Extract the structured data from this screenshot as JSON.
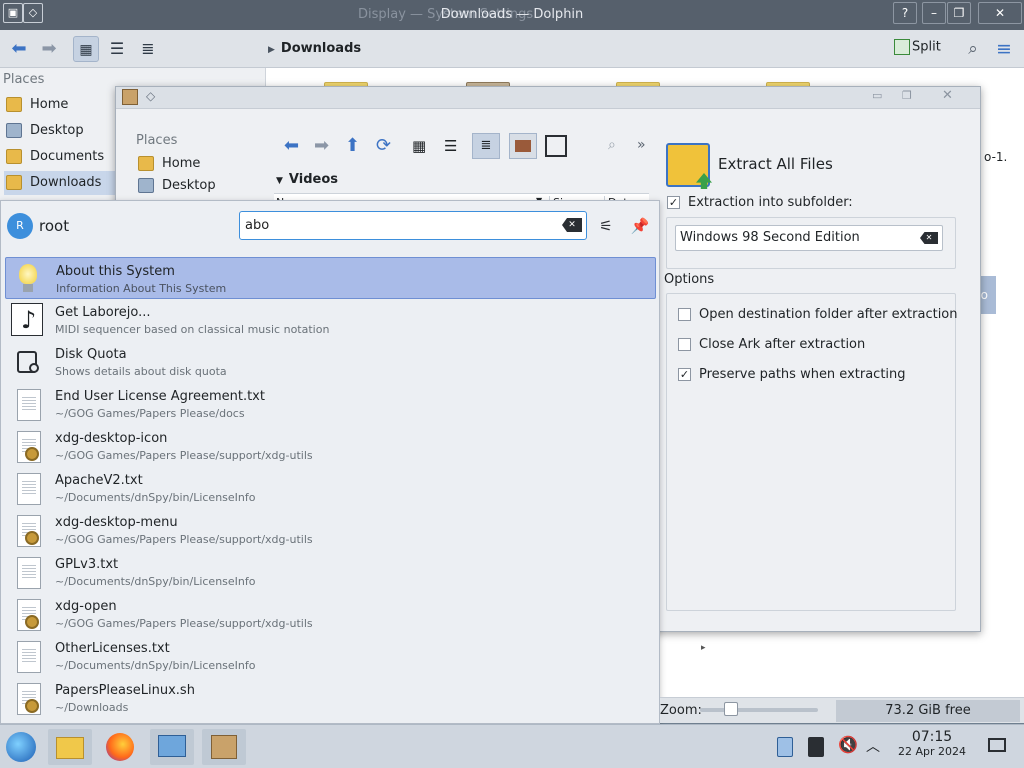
{
  "dolphin": {
    "title": "Downloads — Dolphin",
    "ghost_title": "Display — System Settings",
    "breadcrumb": "Downloads",
    "split_label": "Split",
    "places_header": "Places",
    "places": [
      "Home",
      "Desktop",
      "Documents",
      "Downloads"
    ],
    "right_peek_text": "o-1.",
    "right_peek_text2": "iso"
  },
  "ark": {
    "places_header": "Places",
    "places": [
      "Home",
      "Desktop"
    ],
    "folder": "Videos",
    "columns": [
      "Name",
      "Size",
      "Date"
    ],
    "extract_title": "Extract All Files",
    "subfolder_label": "Extraction into subfolder:",
    "subfolder_value": "Windows 98 Second Edition",
    "options_header": "Options",
    "options": [
      {
        "label": "Open destination folder after extraction",
        "checked": false
      },
      {
        "label": "Close Ark after extraction",
        "checked": false
      },
      {
        "label": "Preserve paths when extracting",
        "checked": true
      }
    ]
  },
  "krunner": {
    "user": "root",
    "avatar_letter": "R",
    "query": "abo",
    "results": [
      {
        "title": "About this System",
        "subtitle": "Information About This System",
        "icon": "bulb-icon"
      },
      {
        "title": "Get Laborejo...",
        "subtitle": "MIDI sequencer based on classical music notation",
        "icon": "music-note-icon"
      },
      {
        "title": "Disk Quota",
        "subtitle": "Shows details about disk quota",
        "icon": "disk-quota-icon"
      },
      {
        "title": "End User License Agreement.txt",
        "subtitle": "~/GOG Games/Papers Please/docs",
        "icon": "text-file-icon"
      },
      {
        "title": "xdg-desktop-icon",
        "subtitle": "~/GOG Games/Papers Please/support/xdg-utils",
        "icon": "script-file-icon"
      },
      {
        "title": "ApacheV2.txt",
        "subtitle": "~/Documents/dnSpy/bin/LicenseInfo",
        "icon": "text-file-icon"
      },
      {
        "title": "xdg-desktop-menu",
        "subtitle": "~/GOG Games/Papers Please/support/xdg-utils",
        "icon": "script-file-icon"
      },
      {
        "title": "GPLv3.txt",
        "subtitle": "~/Documents/dnSpy/bin/LicenseInfo",
        "icon": "text-file-icon"
      },
      {
        "title": "xdg-open",
        "subtitle": "~/GOG Games/Papers Please/support/xdg-utils",
        "icon": "script-file-icon"
      },
      {
        "title": "OtherLicenses.txt",
        "subtitle": "~/Documents/dnSpy/bin/LicenseInfo",
        "icon": "text-file-icon"
      },
      {
        "title": "PapersPleaseLinux.sh",
        "subtitle": "~/Downloads",
        "icon": "script-file-icon"
      }
    ]
  },
  "status": {
    "zoom_label": "Zoom:",
    "free_space": "73.2 GiB free"
  },
  "taskbar": {
    "time": "07:15",
    "date": "22 Apr 2024"
  }
}
